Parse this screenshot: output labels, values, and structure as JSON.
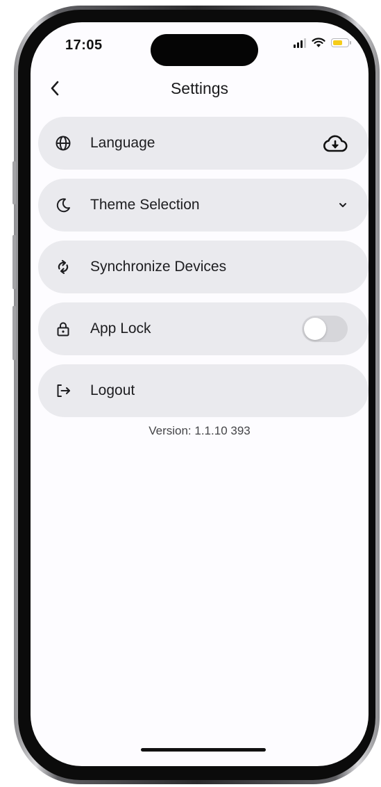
{
  "status_bar": {
    "time": "17:05",
    "icons": [
      "signal-icon",
      "wifi-icon",
      "battery-icon"
    ],
    "battery_color": "#f5cc19"
  },
  "header": {
    "back_icon": "chevron-left-icon",
    "title": "Settings"
  },
  "settings": {
    "items": [
      {
        "icon": "globe-icon",
        "label": "Language",
        "trailing": "cloud-download-icon"
      },
      {
        "icon": "moon-icon",
        "label": "Theme Selection",
        "trailing": "chevron-down-icon"
      },
      {
        "icon": "sync-icon",
        "label": "Synchronize Devices",
        "trailing": ""
      },
      {
        "icon": "lock-icon",
        "label": "App Lock",
        "trailing": "toggle",
        "toggle_on": false
      },
      {
        "icon": "logout-icon",
        "label": "Logout",
        "trailing": ""
      }
    ]
  },
  "footer": {
    "version": "Version: 1.1.10 393"
  },
  "colors": {
    "row_background": "#eaeaee",
    "screen_background": "#fdfcff",
    "text": "#1d1d20"
  }
}
